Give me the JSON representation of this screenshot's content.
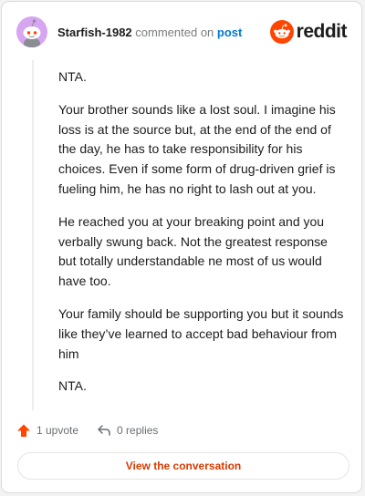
{
  "comment": {
    "username": "Starfish-1982",
    "action": "commented on",
    "target": "post",
    "paragraphs": [
      "NTA.",
      "Your brother sounds like a lost soul. I imagine his loss is at the source but, at the end of the end of the day, he has to take responsibility for his choices. Even if some form of drug-driven grief is fueling him, he has no right to lash out at you.",
      "He reached you at your breaking point and you verbally swung back. Not the greatest response but totally understandable ne most of us would have too.",
      "Your family should be supporting you but it sounds like they’ve learned to accept bad behaviour from him",
      "NTA."
    ]
  },
  "brand": {
    "name": "reddit",
    "icon": "reddit-logo-icon",
    "color": "#ff4500"
  },
  "actions": {
    "upvotes": "1 upvote",
    "replies": "0 replies",
    "upvote_icon": "upvote-arrow-icon",
    "reply_icon": "reply-arrow-icon"
  },
  "cta": {
    "label": "View the conversation",
    "color": "#d93a00"
  }
}
